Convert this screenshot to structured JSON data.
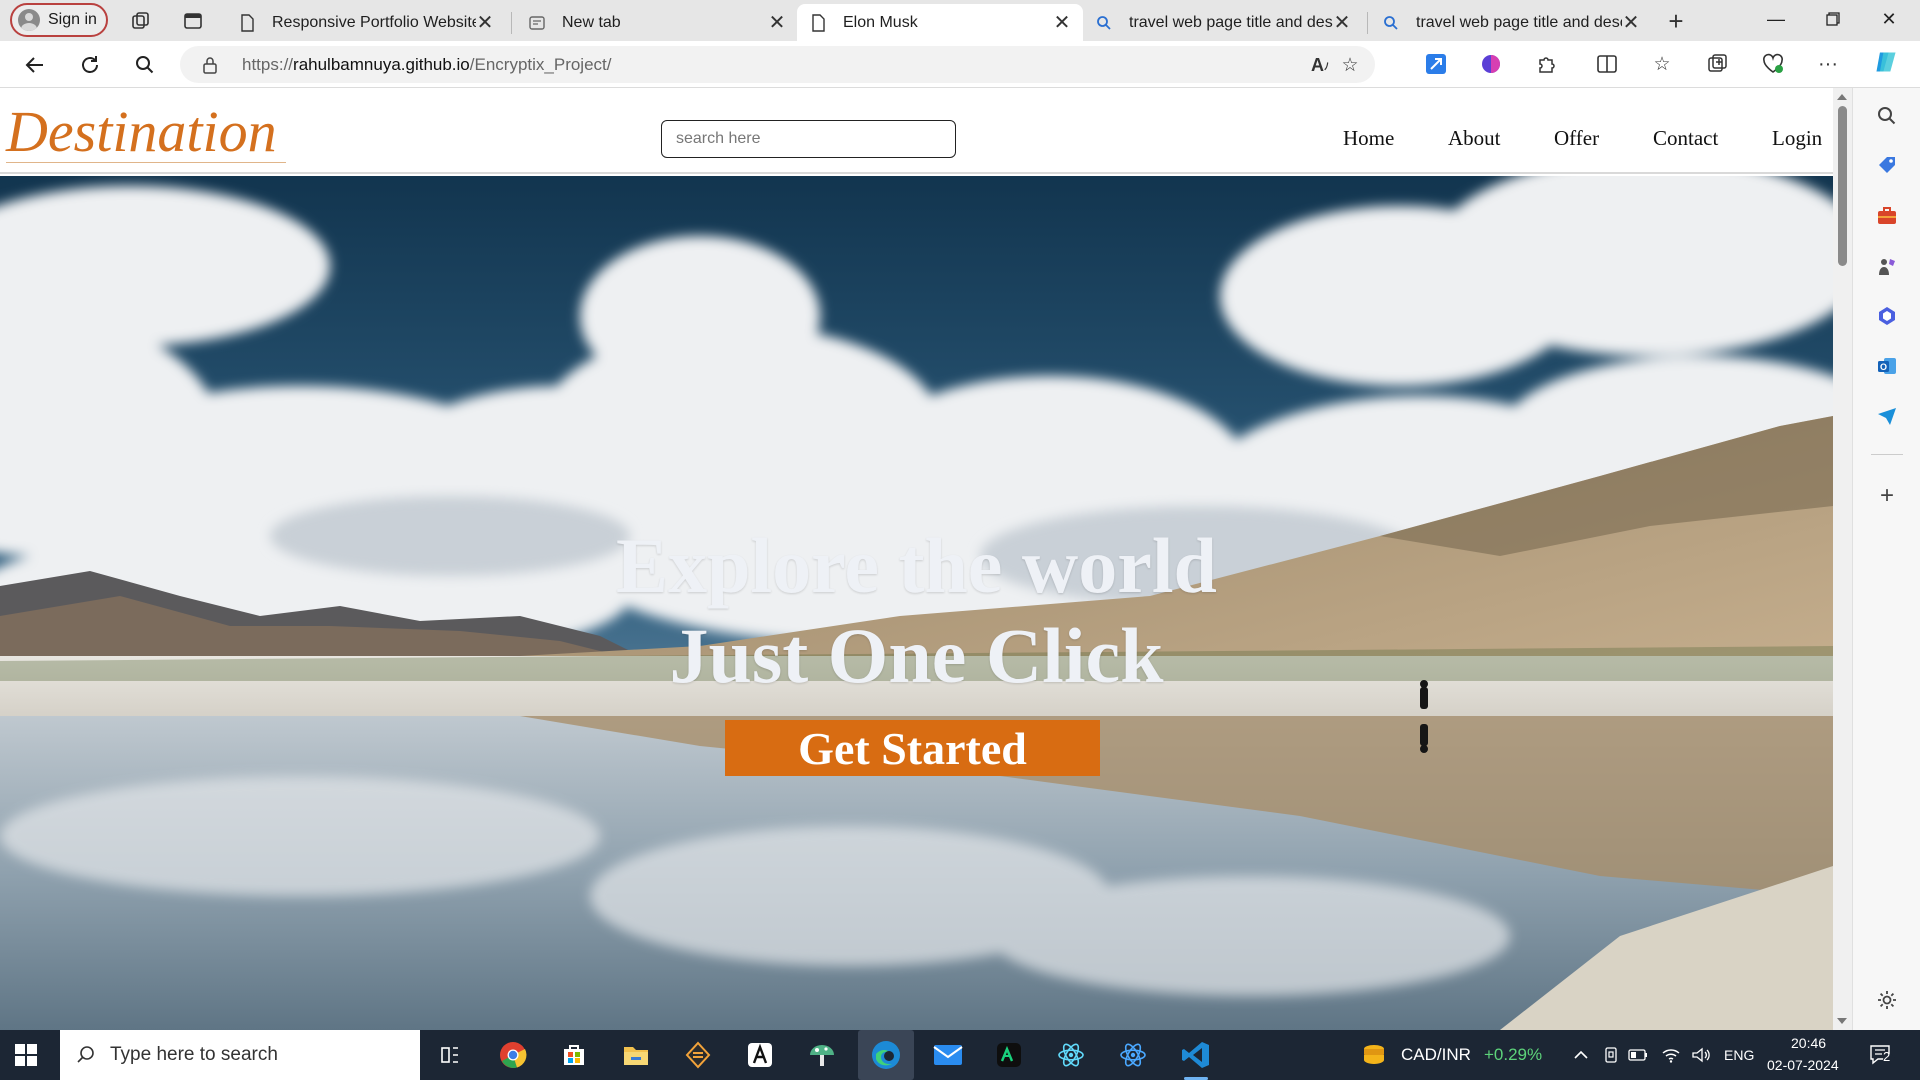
{
  "browser": {
    "profile_label": "Sign in",
    "tabs": [
      {
        "title": "Responsive Portfolio Website",
        "icon": "page-icon"
      },
      {
        "title": "New tab",
        "icon": "newtab-icon"
      },
      {
        "title": "Elon Musk",
        "icon": "page-icon",
        "active": true
      },
      {
        "title": "travel web page title and descr",
        "icon": "search-icon"
      },
      {
        "title": "travel web page title and descr",
        "icon": "search-icon"
      }
    ],
    "url_prefix": "https://",
    "url_host": "rahulbamnuya.github.io",
    "url_path": "/Encryptix_Project/"
  },
  "site": {
    "logo": "Destination",
    "search_placeholder": "search here",
    "menu": [
      "Home",
      "About",
      "Offer",
      "Contact",
      "Login"
    ],
    "hero": {
      "line1": "Explore the world",
      "line2": "Just One Click",
      "cta": "Get Started"
    },
    "colors": {
      "brand": "#d4701e",
      "cta": "#d86c12"
    }
  },
  "taskbar": {
    "search_placeholder": "Type here to search",
    "ticker_symbol": "CAD/INR",
    "ticker_change": "+0.29%",
    "language": "ENG",
    "time": "20:46",
    "date": "02-07-2024",
    "notification_count": "2"
  }
}
